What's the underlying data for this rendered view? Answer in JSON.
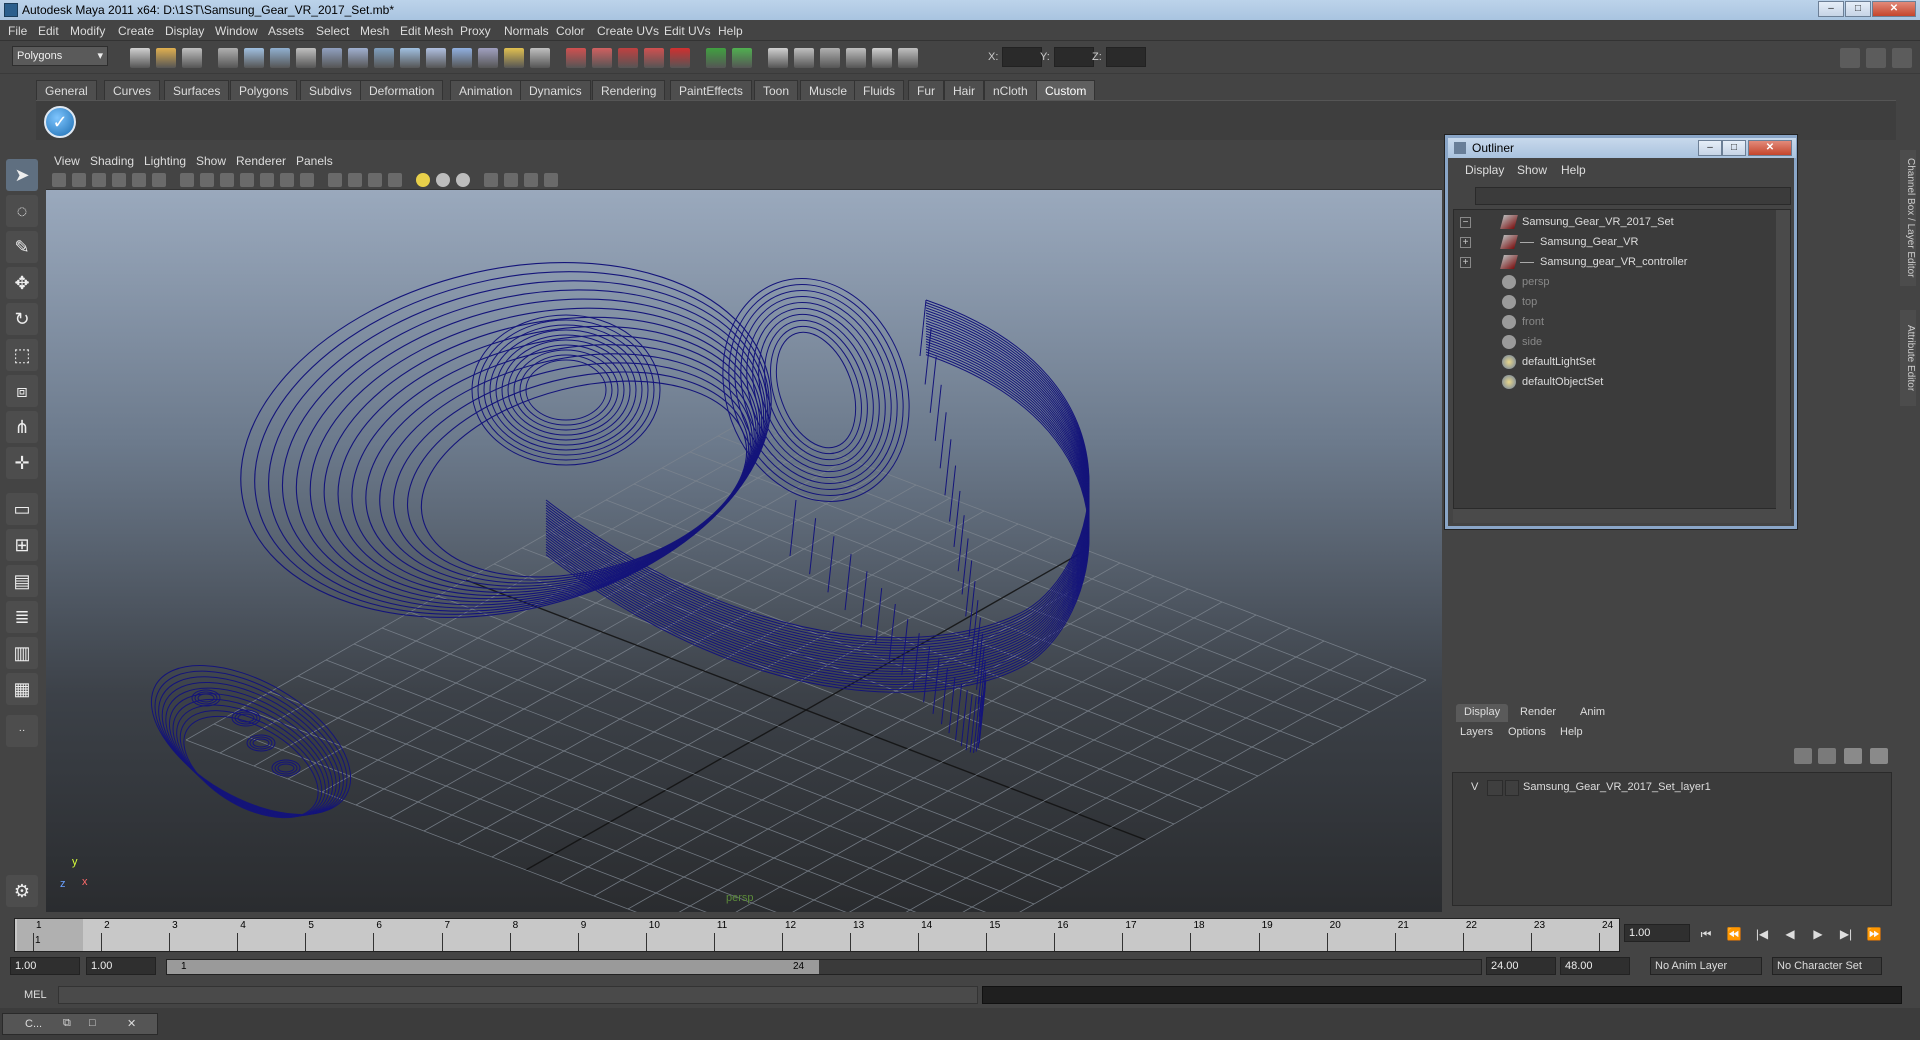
{
  "window": {
    "title": "Autodesk Maya 2011 x64: D:\\1ST\\Samsung_Gear_VR_2017_Set.mb*",
    "min": "–",
    "max": "□",
    "close": "✕"
  },
  "menubar": [
    "File",
    "Edit",
    "Modify",
    "Create",
    "Display",
    "Window",
    "Assets",
    "Select",
    "Mesh",
    "Edit Mesh",
    "Proxy",
    "Normals",
    "Color",
    "Create UVs",
    "Edit UVs",
    "Help"
  ],
  "statusline": {
    "mode": "Polygons",
    "x_label": "X:",
    "y_label": "Y:",
    "z_label": "Z:"
  },
  "shelf": {
    "tabs": [
      "General",
      "Curves",
      "Surfaces",
      "Polygons",
      "Subdivs",
      "Deformation",
      "Animation",
      "Dynamics",
      "Rendering",
      "PaintEffects",
      "Toon",
      "Muscle",
      "Fluids",
      "Fur",
      "Hair",
      "nCloth",
      "Custom"
    ],
    "active_tab": "Custom",
    "check_glyph": "✓"
  },
  "viewport": {
    "menu": [
      "View",
      "Shading",
      "Lighting",
      "Show",
      "Renderer",
      "Panels"
    ],
    "camera_label": "persp",
    "axis_y": "y",
    "axis_x": "x",
    "axis_z": "z",
    "wire_color": "#14147a"
  },
  "outliner": {
    "title": "Outliner",
    "menu": [
      "Display",
      "Show",
      "Help"
    ],
    "items": [
      {
        "label": "Samsung_Gear_VR_2017_Set",
        "expander": "−",
        "icon": "transform-icon",
        "dim": false
      },
      {
        "label": "Samsung_Gear_VR",
        "expander": "+",
        "icon": "transform-icon",
        "dim": false
      },
      {
        "label": "Samsung_gear_VR_controller",
        "expander": "+",
        "icon": "transform-icon",
        "dim": false
      },
      {
        "label": "persp",
        "expander": "",
        "icon": "camera-icon",
        "dim": true
      },
      {
        "label": "top",
        "expander": "",
        "icon": "camera-icon",
        "dim": true
      },
      {
        "label": "front",
        "expander": "",
        "icon": "camera-icon",
        "dim": true
      },
      {
        "label": "side",
        "expander": "",
        "icon": "camera-icon",
        "dim": true
      },
      {
        "label": "defaultLightSet",
        "expander": "",
        "icon": "set-icon",
        "dim": false
      },
      {
        "label": "defaultObjectSet",
        "expander": "",
        "icon": "set-icon",
        "dim": false
      }
    ]
  },
  "layer_editor": {
    "tabs": [
      "Display",
      "Render",
      "Anim"
    ],
    "active_tab": "Display",
    "menu": [
      "Layers",
      "Options",
      "Help"
    ],
    "layer": {
      "visibility": "V",
      "name": "Samsung_Gear_VR_2017_Set_layer1"
    }
  },
  "side_tabs": [
    "Channel Box / Layer Editor",
    "Attribute Editor"
  ],
  "timeline": {
    "ticks": [
      "1",
      "2",
      "3",
      "4",
      "5",
      "6",
      "7",
      "8",
      "9",
      "10",
      "11",
      "12",
      "13",
      "14",
      "15",
      "16",
      "17",
      "18",
      "19",
      "20",
      "21",
      "22",
      "23",
      "24"
    ],
    "current_frame_marker": "1",
    "current_time": "1.00"
  },
  "playback": {
    "buttons": [
      "⏮",
      "⏪",
      "|◀",
      "◀",
      "▶",
      "▶|",
      "⏩"
    ]
  },
  "range": {
    "start_time": "1.00",
    "playback_start": "1.00",
    "thumb_start": "1",
    "thumb_end": "24",
    "playback_end": "24.00",
    "end_time": "48.00",
    "anim_layer": "No Anim Layer",
    "character_set": "No Character Set"
  },
  "commandline": {
    "label": "MEL"
  },
  "helpline": {
    "minimized_label": "C..."
  }
}
